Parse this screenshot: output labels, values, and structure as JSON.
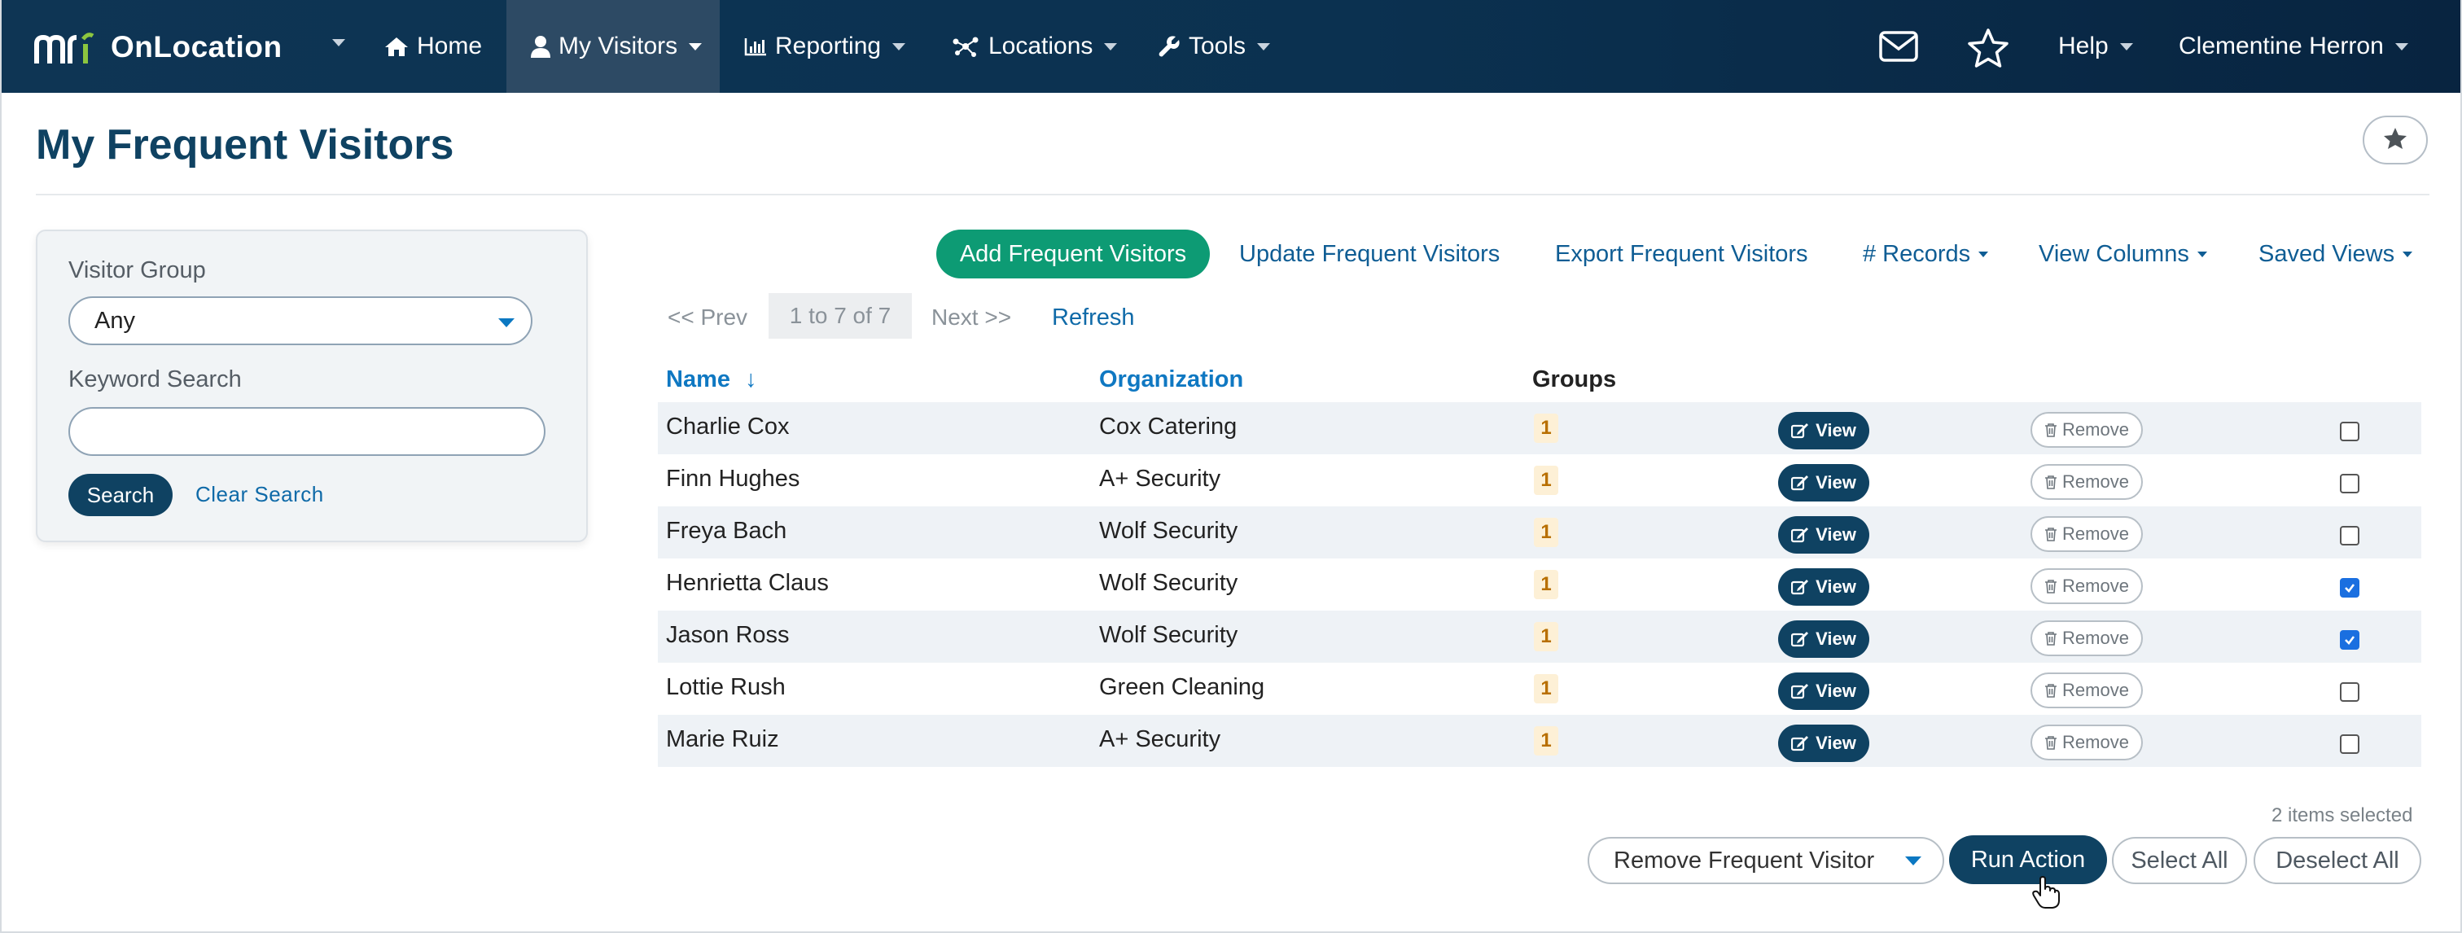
{
  "nav": {
    "brand_name": "OnLocation",
    "items": [
      {
        "label": "Home",
        "icon": "home-icon"
      },
      {
        "label": "My Visitors",
        "icon": "user-icon"
      },
      {
        "label": "Reporting",
        "icon": "bar-chart-icon"
      },
      {
        "label": "Locations",
        "icon": "network-icon"
      },
      {
        "label": "Tools",
        "icon": "wrench-icon"
      }
    ],
    "help_label": "Help",
    "user_name": "Clementine Herron",
    "icons": [
      "mail-icon",
      "star-icon"
    ]
  },
  "page": {
    "title": "My Frequent Visitors"
  },
  "search": {
    "group_label": "Visitor Group",
    "group_value": "Any",
    "keyword_label": "Keyword Search",
    "keyword_value": "",
    "search_button": "Search",
    "clear_link": "Clear Search"
  },
  "actions": {
    "add": "Add Frequent Visitors",
    "update": "Update Frequent Visitors",
    "export": "Export Frequent Visitors",
    "records": "# Records",
    "view_columns": "View Columns",
    "saved_views": "Saved Views"
  },
  "pager": {
    "prev": "<< Prev",
    "count": "1 to 7 of 7",
    "next": "Next >>",
    "refresh": "Refresh"
  },
  "table": {
    "columns": {
      "name": "Name",
      "organization": "Organization",
      "groups": "Groups"
    },
    "sort_arrow": "↓",
    "view_label": "View",
    "remove_label": "Remove",
    "rows": [
      {
        "name": "Charlie Cox",
        "organization": "Cox Catering",
        "groups": "1",
        "checked": false
      },
      {
        "name": "Finn Hughes",
        "organization": "A+ Security",
        "groups": "1",
        "checked": false
      },
      {
        "name": "Freya Bach",
        "organization": "Wolf Security",
        "groups": "1",
        "checked": false
      },
      {
        "name": "Henrietta Claus",
        "organization": "Wolf Security",
        "groups": "1",
        "checked": true
      },
      {
        "name": "Jason Ross",
        "organization": "Wolf Security",
        "groups": "1",
        "checked": true
      },
      {
        "name": "Lottie Rush",
        "organization": "Green Cleaning",
        "groups": "1",
        "checked": false
      },
      {
        "name": "Marie Ruiz",
        "organization": "A+ Security",
        "groups": "1",
        "checked": false
      }
    ]
  },
  "bulk": {
    "selected_count": "2 items selected",
    "action_value": "Remove Frequent Visitor",
    "run": "Run Action",
    "select_all": "Select All",
    "deselect_all": "Deselect All"
  },
  "colors": {
    "navbar": "#0e3554",
    "primary": "#0f4262",
    "accent_green": "#0d9b74",
    "link": "#0f6aa8"
  }
}
